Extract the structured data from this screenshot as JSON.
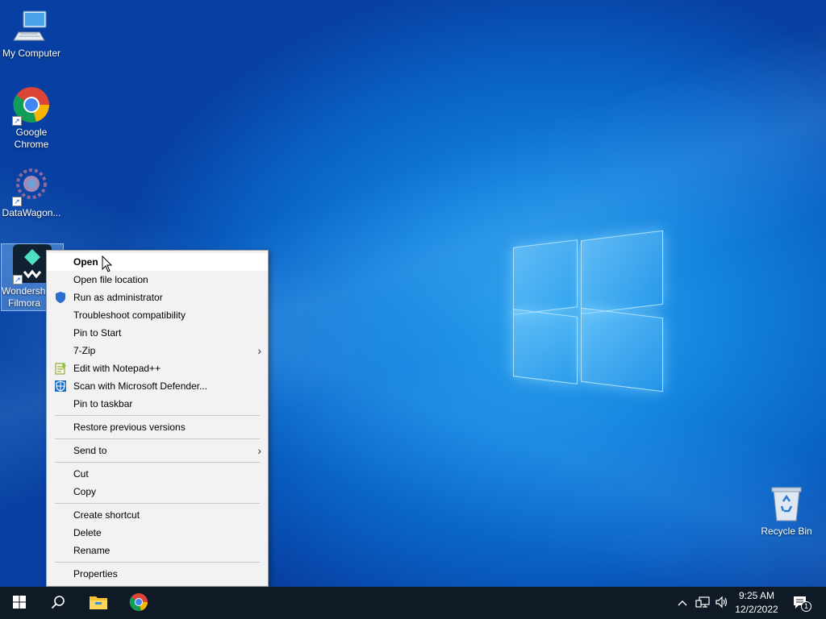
{
  "desktop": {
    "icons": [
      {
        "label": "My Computer",
        "icon": "computer-icon"
      },
      {
        "label": "Google Chrome",
        "icon": "chrome-icon"
      },
      {
        "label": "DataWagon...",
        "icon": "datawagon-icon"
      },
      {
        "label": "Wondershare Filmora",
        "icon": "filmora-icon"
      }
    ],
    "recycle_bin": {
      "label": "Recycle Bin",
      "icon": "recycle-bin-icon"
    }
  },
  "context_menu": {
    "items": [
      {
        "label": "Open",
        "bold": true
      },
      {
        "label": "Open file location"
      },
      {
        "label": "Run as administrator",
        "icon": "uac-shield-icon"
      },
      {
        "label": "Troubleshoot compatibility"
      },
      {
        "label": "Pin to Start"
      },
      {
        "label": "7-Zip",
        "submenu": true
      },
      {
        "label": "Edit with Notepad++",
        "icon": "notepad-plus-plus-icon"
      },
      {
        "label": "Scan with Microsoft Defender...",
        "icon": "defender-icon"
      },
      {
        "label": "Pin to taskbar"
      },
      {
        "label": "Restore previous versions"
      },
      {
        "label": "Send to",
        "submenu": true
      },
      {
        "label": "Cut"
      },
      {
        "label": "Copy"
      },
      {
        "label": "Create shortcut"
      },
      {
        "label": "Delete"
      },
      {
        "label": "Rename"
      },
      {
        "label": "Properties"
      }
    ],
    "submenu_arrow": "›"
  },
  "taskbar": {
    "start": "windows-start-icon",
    "search": "search-icon",
    "pinned": [
      "file-explorer-icon",
      "chrome-icon"
    ],
    "tray": {
      "chevron": "^",
      "time": "9:25 AM",
      "date": "12/2/2022",
      "notification_count": "1"
    }
  }
}
